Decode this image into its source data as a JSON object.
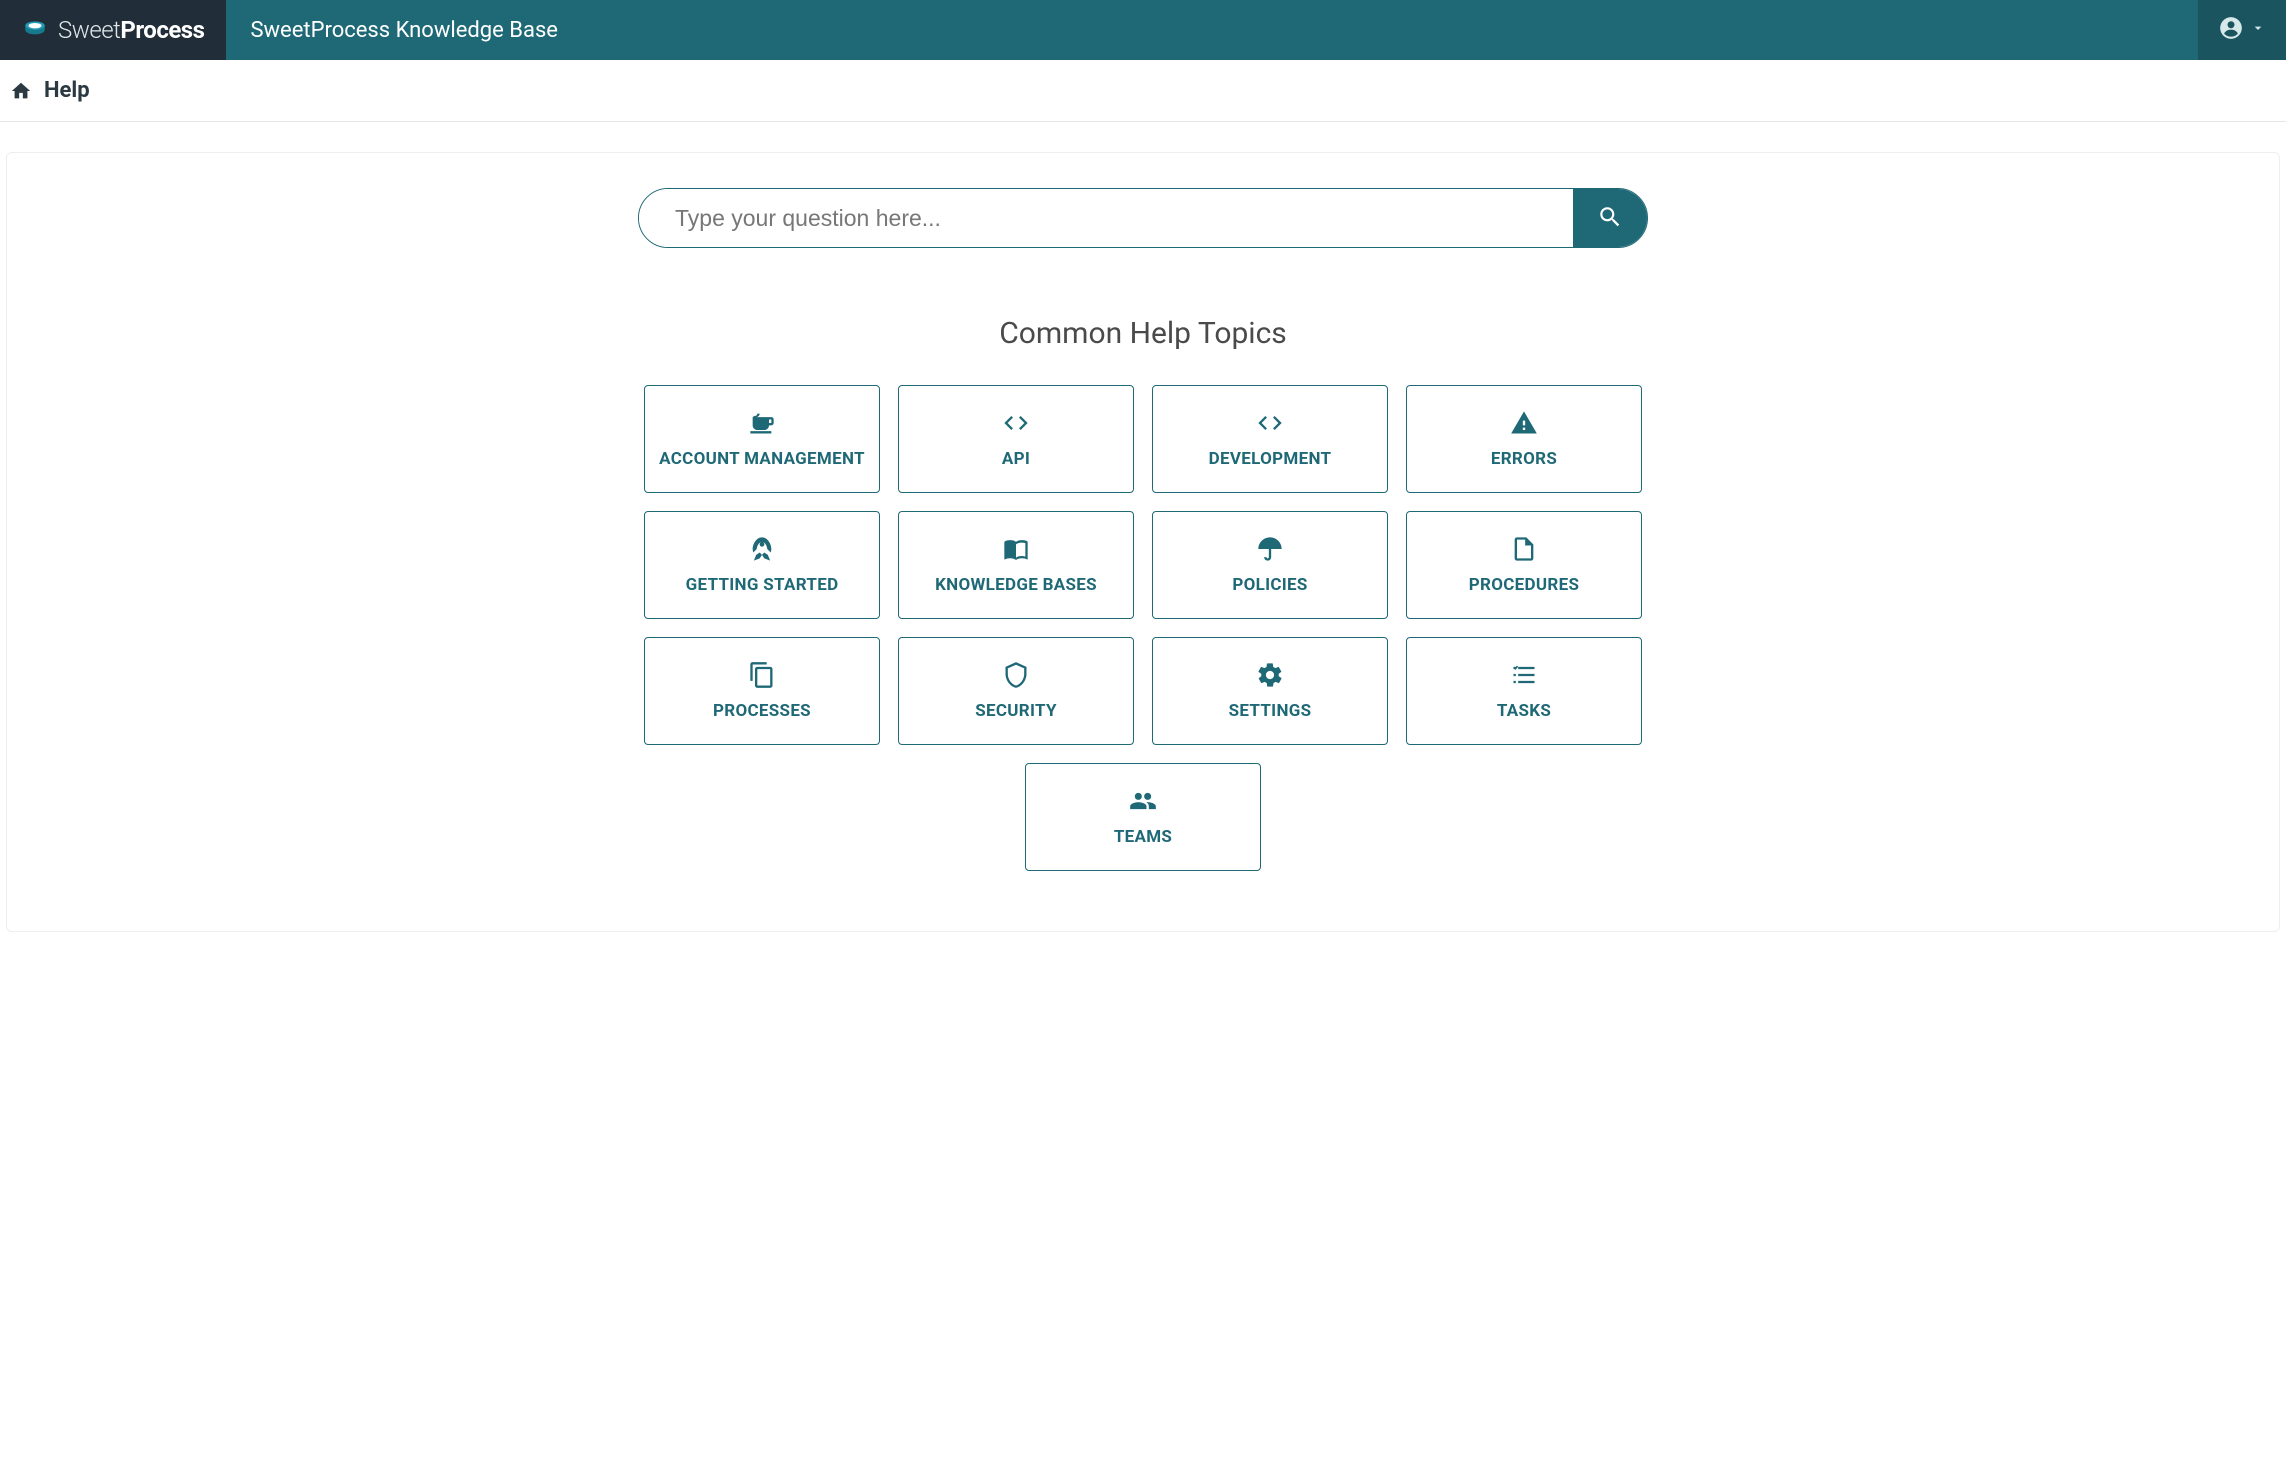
{
  "header": {
    "brand_prefix": "Sweet",
    "brand_suffix": "Process",
    "title": "SweetProcess Knowledge Base"
  },
  "breadcrumb": {
    "label": "Help"
  },
  "search": {
    "placeholder": "Type your question here..."
  },
  "section": {
    "title": "Common Help Topics"
  },
  "topics": [
    {
      "label": "ACCOUNT MANAGEMENT",
      "icon": "coffee"
    },
    {
      "label": "API",
      "icon": "code"
    },
    {
      "label": "DEVELOPMENT",
      "icon": "code"
    },
    {
      "label": "ERRORS",
      "icon": "warning"
    },
    {
      "label": "GETTING STARTED",
      "icon": "rocket"
    },
    {
      "label": "KNOWLEDGE BASES",
      "icon": "book"
    },
    {
      "label": "POLICIES",
      "icon": "umbrella"
    },
    {
      "label": "PROCEDURES",
      "icon": "file"
    },
    {
      "label": "PROCESSES",
      "icon": "copy"
    },
    {
      "label": "SECURITY",
      "icon": "shield"
    },
    {
      "label": "SETTINGS",
      "icon": "gear"
    },
    {
      "label": "TASKS",
      "icon": "tasks"
    },
    {
      "label": "TEAMS",
      "icon": "users"
    }
  ]
}
